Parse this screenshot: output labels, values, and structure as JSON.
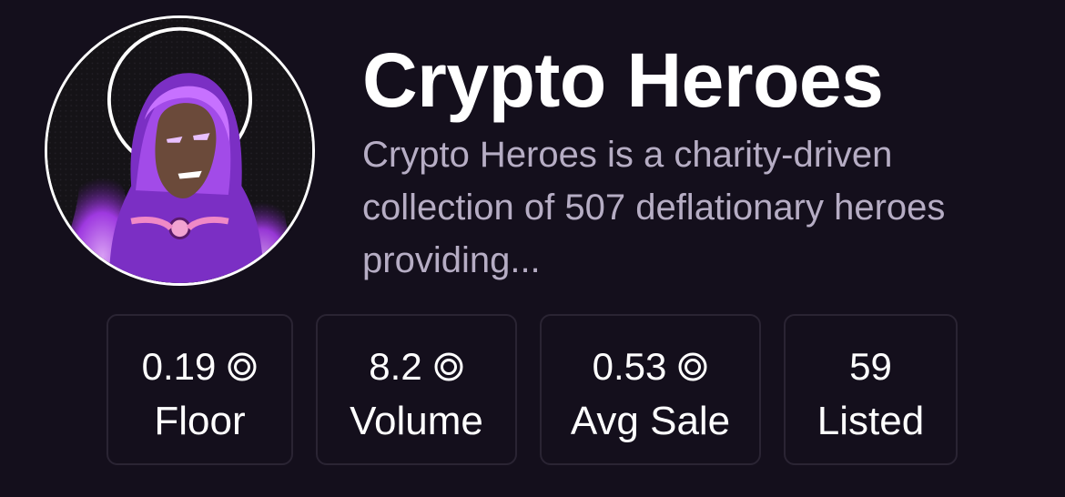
{
  "collection": {
    "title": "Crypto Heroes",
    "description": "Crypto Heroes is a charity-driven collection of 507 deflationary heroes providing..."
  },
  "avatar": {
    "icon": "hooded-hero-avatar",
    "halo_color": "#ffffff",
    "accent_color": "#9b3fd9"
  },
  "stats": [
    {
      "value": "0.19",
      "label": "Floor",
      "icon": "token-icon"
    },
    {
      "value": "8.2",
      "label": "Volume",
      "icon": "token-icon"
    },
    {
      "value": "0.53",
      "label": "Avg Sale",
      "icon": "token-icon"
    },
    {
      "value": "59",
      "label": "Listed"
    }
  ],
  "colors": {
    "background": "#140f1c",
    "description_text": "#b6adc4",
    "card_border": "#2a2433"
  }
}
